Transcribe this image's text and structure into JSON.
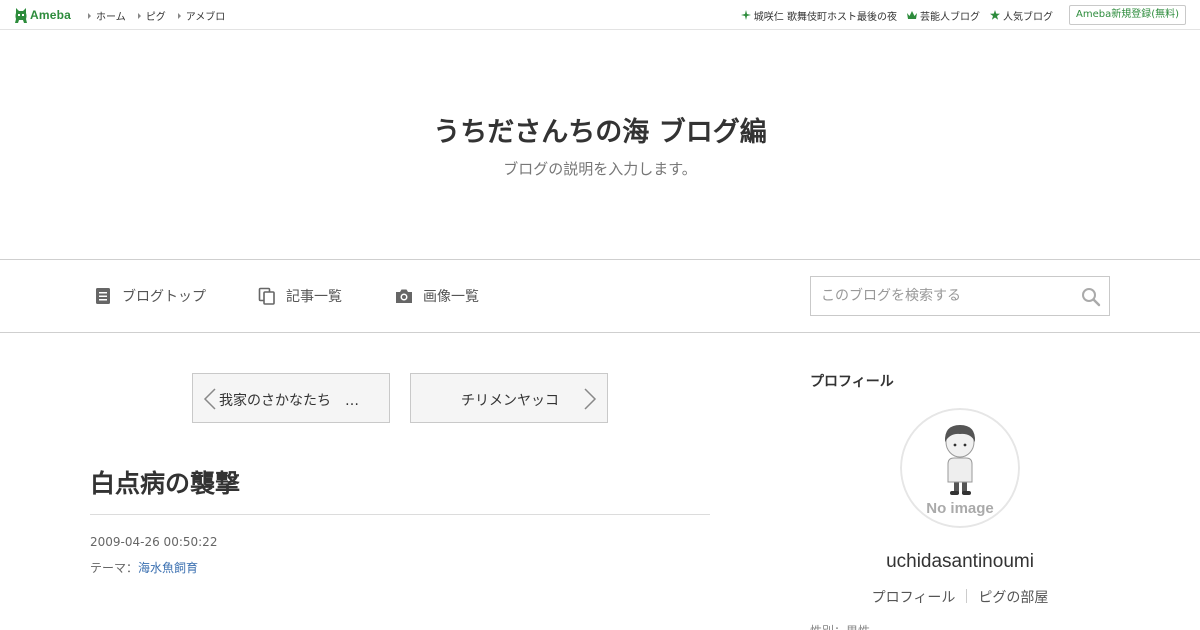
{
  "global_header": {
    "logo_text": "Ameba",
    "brand_color": "#2d8c3c",
    "nav": [
      "ホーム",
      "ピグ",
      "アメブロ"
    ],
    "right_links": [
      {
        "icon": "sparkle-icon",
        "label": "城咲仁 歌舞伎町ホスト最後の夜"
      },
      {
        "icon": "crown-icon",
        "label": "芸能人ブログ"
      },
      {
        "icon": "star-icon",
        "label": "人気ブログ"
      }
    ],
    "register_label": "Ameba新規登録(無料)"
  },
  "blog": {
    "title": "うちださんちの海 ブログ編",
    "description": "ブログの説明を入力します。"
  },
  "navbar": {
    "items": [
      {
        "icon": "document-icon",
        "label": "ブログトップ"
      },
      {
        "icon": "copy-icon",
        "label": "記事一覧"
      },
      {
        "icon": "camera-icon",
        "label": "画像一覧"
      }
    ],
    "search_placeholder": "このブログを検索する"
  },
  "pager": {
    "prev_label": "我家のさかなたち　…",
    "next_label": "チリメンヤッコ"
  },
  "article": {
    "title": "白点病の襲撃",
    "date": "2009-04-26 00:50:22",
    "theme_prefix": "テーマ：",
    "theme": "海水魚飼育"
  },
  "sidebar": {
    "heading": "プロフィール",
    "avatar_text": "No image",
    "username": "uchidasantinoumi",
    "links": [
      "プロフィール",
      "ピグの部屋"
    ],
    "cut_text": "性別：男性"
  }
}
